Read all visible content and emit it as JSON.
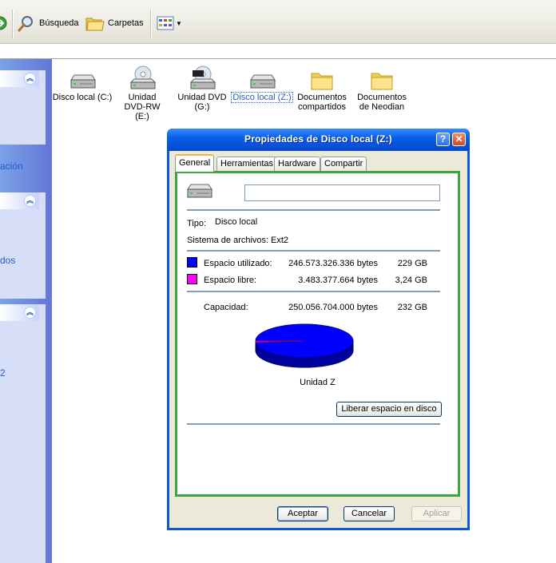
{
  "toolbar": {
    "search_label": "Búsqueda",
    "folders_label": "Carpetas"
  },
  "taskpane": {
    "text1": "ación",
    "text2": "dos",
    "text3": "2"
  },
  "drives": [
    {
      "label": "Disco local (C:)",
      "icon": "hard-drive-icon"
    },
    {
      "label": "Unidad DVD-RW (E:)",
      "icon": "dvd-drive-icon"
    },
    {
      "label": "Unidad DVD (G:)",
      "icon": "dvd-drive-icon"
    },
    {
      "label": "Disco local (Z:)",
      "icon": "hard-drive-icon"
    },
    {
      "label": "Documentos compartidos",
      "icon": "folder-icon"
    },
    {
      "label": "Documentos de Neodian",
      "icon": "folder-icon"
    }
  ],
  "dialog": {
    "title": "Propiedades de Disco local (Z:)",
    "help_btn": "?",
    "close_btn": "✕",
    "tabs": [
      "General",
      "Herramientas",
      "Hardware",
      "Compartir"
    ],
    "name_value": "",
    "type_label": "Tipo:",
    "type_value": "Disco local",
    "fs_label": "Sistema de archivos:",
    "fs_value": "Ext2",
    "used_label": "Espacio utilizado:",
    "used_bytes": "246.573.326.336 bytes",
    "used_gb": "229 GB",
    "free_label": "Espacio libre:",
    "free_bytes": "3.483.377.664 bytes",
    "free_gb": "3,24 GB",
    "capacity_label": "Capacidad:",
    "capacity_bytes": "250.056.704.000 bytes",
    "capacity_gb": "232 GB",
    "drive_caption": "Unidad Z",
    "cleanup_button": "Liberar espacio en disco",
    "ok_button": "Aceptar",
    "cancel_button": "Cancelar",
    "apply_button": "Aplicar",
    "used_color": "#0000ff",
    "free_color": "#ff00ff",
    "used_fraction": 0.986
  }
}
